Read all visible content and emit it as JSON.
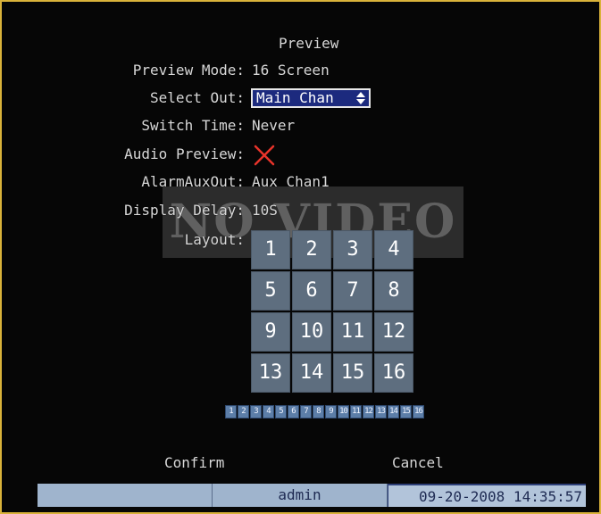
{
  "title": "Preview",
  "no_video": "NO VIDEO",
  "fields": {
    "preview_mode": {
      "label": "Preview Mode:",
      "value": "16 Screen"
    },
    "select_out": {
      "label": "Select Out:",
      "value": "Main Chan"
    },
    "switch_time": {
      "label": "Switch Time:",
      "value": "Never"
    },
    "audio_preview": {
      "label": "Audio Preview:",
      "checked": false,
      "mark_color": "#e8342a"
    },
    "alarm_aux_out": {
      "label": "AlarmAuxOut:",
      "value": "Aux Chan1"
    },
    "display_delay": {
      "label": "Display Delay:",
      "value": "10S"
    },
    "layout": {
      "label": "Layout:"
    }
  },
  "layout_grid": [
    "1",
    "2",
    "3",
    "4",
    "5",
    "6",
    "7",
    "8",
    "9",
    "10",
    "11",
    "12",
    "13",
    "14",
    "15",
    "16"
  ],
  "channel_strip": [
    "1",
    "2",
    "3",
    "4",
    "5",
    "6",
    "7",
    "8",
    "9",
    "10",
    "11",
    "12",
    "13",
    "14",
    "15",
    "16"
  ],
  "buttons": {
    "confirm": "Confirm",
    "cancel": "Cancel"
  },
  "status_bar": {
    "left": "",
    "user": "admin",
    "datetime": "09-20-2008 14:35:57"
  },
  "colors": {
    "background": "#060606",
    "frame_border": "#d9b23a",
    "selected_field_bg": "#1c2a7e",
    "grid_cell": "#5e6e7f",
    "channel_chip": "#5c7ea8",
    "status_bar": "#9fb4cd"
  },
  "icons": {
    "select_arrows": "up-down-arrows-icon",
    "audio_off": "red-cross-icon"
  }
}
